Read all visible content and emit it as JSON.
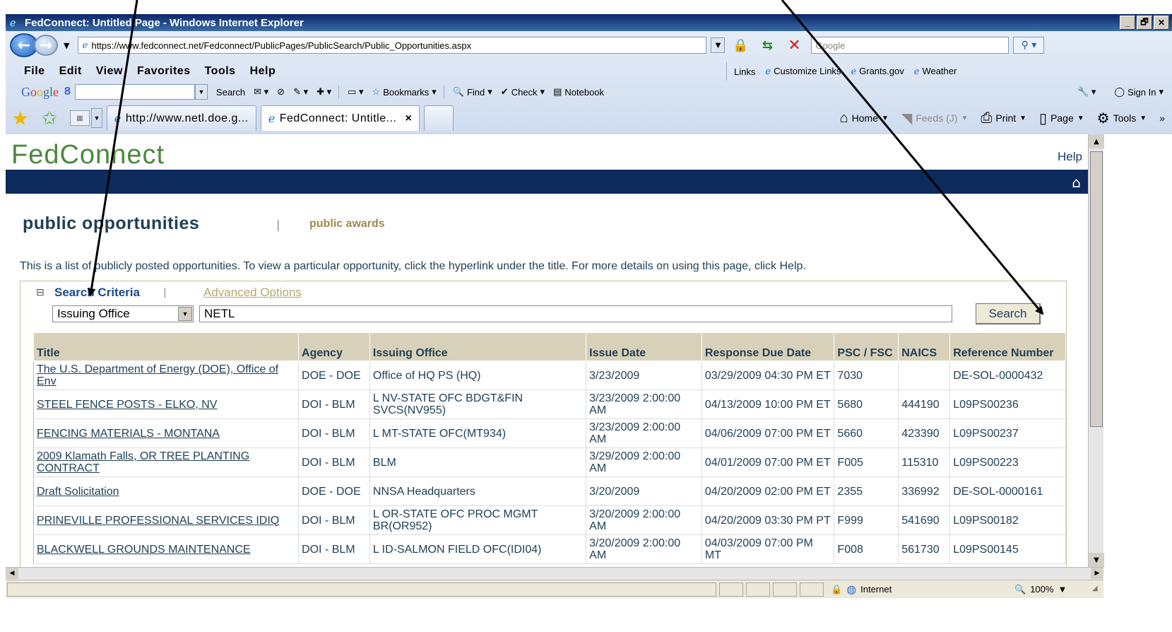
{
  "window": {
    "title": "FedConnect: Untitled Page - Windows Internet Explorer",
    "buttons": [
      "_",
      "🗗",
      "✕"
    ]
  },
  "address_bar": {
    "url": "https://www.fedconnect.net/Fedconnect/PublicPages/PublicSearch/Public_Opportunities.aspx",
    "search_placeholder": "Google"
  },
  "menu": [
    "File",
    "Edit",
    "View",
    "Favorites",
    "Tools",
    "Help"
  ],
  "links_bar": {
    "label": "Links",
    "items": [
      "Customize Links",
      "Grants.gov",
      "Weather"
    ]
  },
  "google_toolbar": {
    "logo": "Google",
    "eight": "8",
    "search_label": "Search",
    "bookmarks_label": "Bookmarks",
    "find_label": "Find",
    "check_label": "Check",
    "notebook_label": "Notebook",
    "sign_in_label": "Sign In"
  },
  "tabs": [
    {
      "label": "http://www.netl.doe.g..."
    },
    {
      "label": "FedConnect: Untitle..."
    }
  ],
  "command_bar": {
    "home": "Home",
    "feeds": "Feeds (J)",
    "print": "Print",
    "page": "Page",
    "tools": "Tools",
    "more": "»"
  },
  "site": {
    "logo": "FedConnect",
    "help": "Help"
  },
  "page": {
    "heading": "public opportunities",
    "separator": "|",
    "awards_link": "public awards",
    "intro": "This is a list of publicly posted opportunities. To view a particular opportunity, click the hyperlink under the title. For more details on using this page, click Help."
  },
  "search": {
    "toggle": "⊟",
    "criteria_label": "Search Criteria",
    "separator": "|",
    "advanced_label": "Advanced Options",
    "field_selected": "Issuing Office",
    "query_value": "NETL",
    "button_label": "Search"
  },
  "table": {
    "headers": [
      "Title",
      "Agency",
      "Issuing Office",
      "Issue Date",
      "Response Due Date",
      "PSC / FSC",
      "NAICS",
      "Reference Number"
    ],
    "rows": [
      {
        "title": "The U.S. Department of Energy (DOE), Office of Env",
        "agency": "DOE - DOE",
        "office": "Office of HQ PS (HQ)",
        "issue": "3/23/2009",
        "due": "03/29/2009 04:30 PM ET",
        "psc": "7030",
        "naics": "",
        "ref": "DE-SOL-0000432"
      },
      {
        "title": "STEEL FENCE POSTS - ELKO, NV",
        "agency": "DOI - BLM",
        "office": "L NV-STATE OFC BDGT&FIN SVCS(NV955)",
        "issue": "3/23/2009 2:00:00 AM",
        "due": "04/13/2009 10:00 PM ET",
        "psc": "5680",
        "naics": "444190",
        "ref": "L09PS00236"
      },
      {
        "title": "FENCING MATERIALS - MONTANA",
        "agency": "DOI - BLM",
        "office": "L MT-STATE OFC(MT934)",
        "issue": "3/23/2009 2:00:00 AM",
        "due": "04/06/2009 07:00 PM ET",
        "psc": "5660",
        "naics": "423390",
        "ref": "L09PS00237"
      },
      {
        "title": "2009 Klamath Falls, OR TREE PLANTING CONTRACT",
        "agency": "DOI - BLM",
        "office": "BLM",
        "issue": "3/29/2009 2:00:00 AM",
        "due": "04/01/2009 07:00 PM ET",
        "psc": "F005",
        "naics": "115310",
        "ref": "L09PS00223"
      },
      {
        "title": "Draft Solicitation",
        "agency": "DOE - DOE",
        "office": "NNSA Headquarters",
        "issue": "3/20/2009",
        "due": "04/20/2009 02:00 PM ET",
        "psc": "2355",
        "naics": "336992",
        "ref": "DE-SOL-0000161"
      },
      {
        "title": "PRINEVILLE PROFESSIONAL SERVICES IDIQ",
        "agency": "DOI - BLM",
        "office": "L OR-STATE OFC PROC MGMT BR(OR952)",
        "issue": "3/20/2009 2:00:00 AM",
        "due": "04/20/2009 03:30 PM PT",
        "psc": "F999",
        "naics": "541690",
        "ref": "L09PS00182"
      },
      {
        "title": "BLACKWELL GROUNDS MAINTENANCE",
        "agency": "DOI - BLM",
        "office": "L ID-SALMON FIELD OFC(IDI04)",
        "issue": "3/20/2009 2:00:00 AM",
        "due": "04/03/2009 07:00 PM MT",
        "psc": "F008",
        "naics": "561730",
        "ref": "L09PS00145"
      }
    ]
  },
  "statusbar": {
    "zone": "Internet",
    "zoom": "100%"
  }
}
